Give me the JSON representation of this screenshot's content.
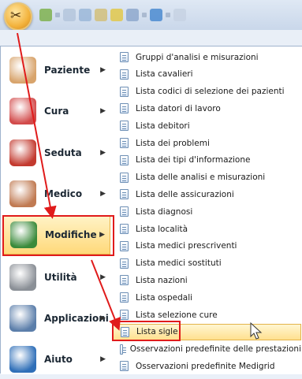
{
  "left_menu": [
    {
      "label": "Paziente",
      "icon": "patient-icon",
      "color": "#d8a46c"
    },
    {
      "label": "Cura",
      "icon": "care-icon",
      "color": "#d24a4a"
    },
    {
      "label": "Seduta",
      "icon": "session-icon",
      "color": "#c33a2f"
    },
    {
      "label": "Medico",
      "icon": "doctor-icon",
      "color": "#c07a52"
    },
    {
      "label": "Modifiche",
      "icon": "edit-icon",
      "color": "#3a8a3a"
    },
    {
      "label": "Utilità",
      "icon": "utility-icon",
      "color": "#8a8f96"
    },
    {
      "label": "Applicazioni",
      "icon": "application-icon",
      "color": "#5b7eaa"
    },
    {
      "label": "Aiuto",
      "icon": "help-icon",
      "color": "#2f6fb8"
    }
  ],
  "submenu": [
    "Gruppi d'analisi e misurazioni",
    "Lista cavalieri",
    "Lista codici di selezione dei pazienti",
    "Lista datori di lavoro",
    "Lista debitori",
    "Lista dei problemi",
    "Lista dei tipi d'informazione",
    "Lista delle analisi e misurazioni",
    "Lista delle assicurazioni",
    "Lista diagnosi",
    "Lista località",
    "Lista medici prescriventi",
    "Lista medici sostituti",
    "Lista nazioni",
    "Lista ospedali",
    "Lista selezione cure",
    "Lista sigle",
    "Osservazioni predefinite delle prestazioni",
    "Osservazioni predefinite Medigrid"
  ],
  "selected_category": "Modifiche",
  "selected_item": "Lista sigle"
}
